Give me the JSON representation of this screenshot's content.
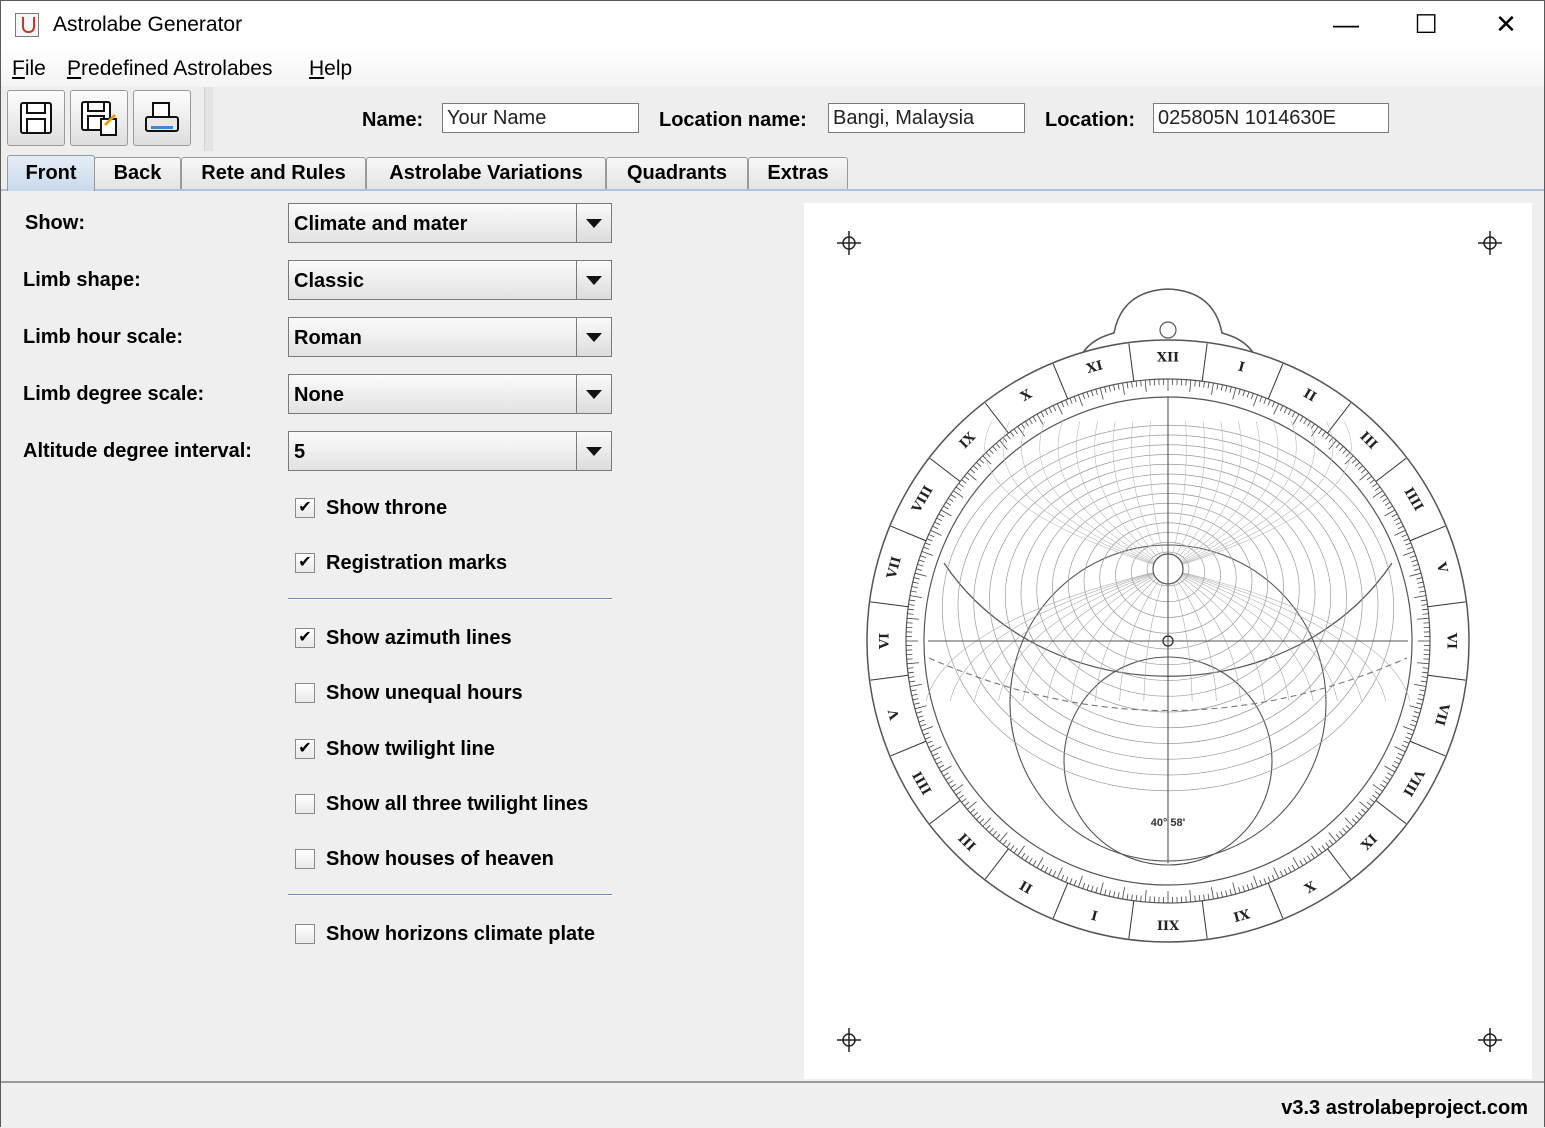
{
  "window": {
    "title": "Astrolabe Generator",
    "minimize": "—",
    "maximize": "☐",
    "close": "✕"
  },
  "menu": [
    {
      "mnemonic": "F",
      "rest": "ile"
    },
    {
      "mnemonic": "P",
      "rest": "redefined Astrolabes"
    },
    {
      "mnemonic": "H",
      "rest": "elp"
    }
  ],
  "toolbar": {
    "buttons": [
      "save-icon",
      "save-as-icon",
      "print-icon"
    ],
    "name_label": "Name:",
    "name_value": "Your Name",
    "location_name_label": "Location name:",
    "location_name_value": "Bangi, Malaysia",
    "location_label": "Location:",
    "location_value": "025805N 1014630E"
  },
  "tabs": [
    "Front",
    "Back",
    "Rete and Rules",
    "Astrolabe Variations",
    "Quadrants",
    "Extras"
  ],
  "active_tab": "Front",
  "form": {
    "show": {
      "label": "Show:",
      "value": "Climate and mater"
    },
    "limb_shape": {
      "label": "Limb shape:",
      "value": "Classic"
    },
    "limb_hour_scale": {
      "label": "Limb hour scale:",
      "value": "Roman"
    },
    "limb_degree_scale": {
      "label": "Limb degree scale:",
      "value": "None"
    },
    "altitude_interval": {
      "label": "Altitude degree interval:",
      "value": "5"
    }
  },
  "checkboxes": [
    {
      "label": "Show throne",
      "checked": true
    },
    {
      "label": "Registration marks",
      "checked": true
    },
    {
      "label": "Show azimuth lines",
      "checked": true
    },
    {
      "label": "Show unequal hours",
      "checked": false
    },
    {
      "label": "Show twilight line",
      "checked": true
    },
    {
      "label": "Show all three twilight lines",
      "checked": false
    },
    {
      "label": "Show houses of heaven",
      "checked": false
    },
    {
      "label": "Show horizons climate plate",
      "checked": false
    }
  ],
  "preview": {
    "hour_numerals": [
      "XII",
      "I",
      "II",
      "III",
      "IIII",
      "V",
      "VI",
      "VII",
      "VIII",
      "IX",
      "X",
      "XI",
      "XII",
      "I",
      "II",
      "III",
      "IIII",
      "V",
      "VI",
      "VII",
      "VIII",
      "IX",
      "X",
      "XI"
    ],
    "latitude_label": "40° 58'"
  },
  "status": {
    "text": "v3.3 astrolabeproject.com"
  }
}
